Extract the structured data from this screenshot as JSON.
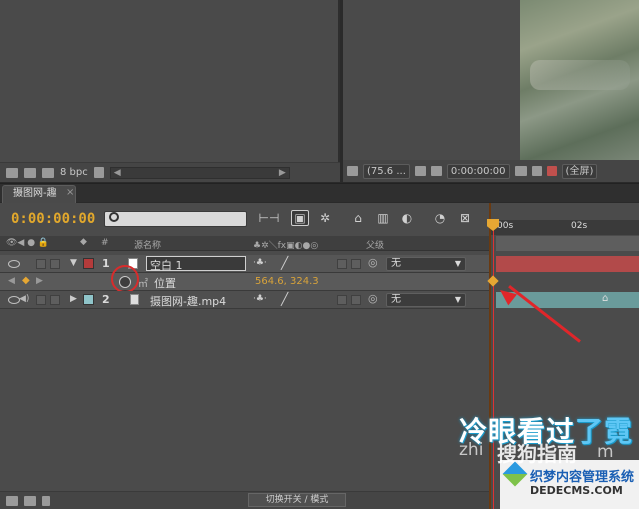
{
  "project_panel": {
    "bpc_label": "8 bpc"
  },
  "comp_viewer": {
    "zoom": "(75.6 ...",
    "timecode": "0:00:00:00",
    "resolution": "(全屏)"
  },
  "timeline": {
    "tab_title": "摄图网-趣",
    "current_time": "0:00:00:00",
    "search_placeholder": "",
    "ruler": {
      "start_label": "00s",
      "mark_label": "02s"
    },
    "columns": {
      "hash": "#",
      "source_name": "源名称",
      "switches": "♣✲＼fx▣◐●◎",
      "parent": "父级"
    },
    "layers": [
      {
        "index": "1",
        "label_color": "#b43b3b",
        "name": "空白 1",
        "parent": "无",
        "property": {
          "name": "位置",
          "value": "564.6, 324.3"
        }
      },
      {
        "index": "2",
        "label_color": "#8fc4c9",
        "name": "摄图网-趣.mp4",
        "parent": "无"
      }
    ],
    "toggle_button": "切换开关 / 模式"
  },
  "overlay": {
    "caption_main": "冷眼看过",
    "caption_tail": "了霓",
    "watermark_site": "搜狗指南",
    "watermark_url": "zhi",
    "watermark_url_tail": "m",
    "logo_title": "织梦内容管理系统",
    "logo_domain": "DEDECMS.COM"
  },
  "colors": {
    "timecode": "#e2a82c",
    "keyframe": "#e6a733",
    "annotation": "#e0262a",
    "layer1_bar": "#b24a4a",
    "layer2_bar": "#6a9b9b"
  }
}
